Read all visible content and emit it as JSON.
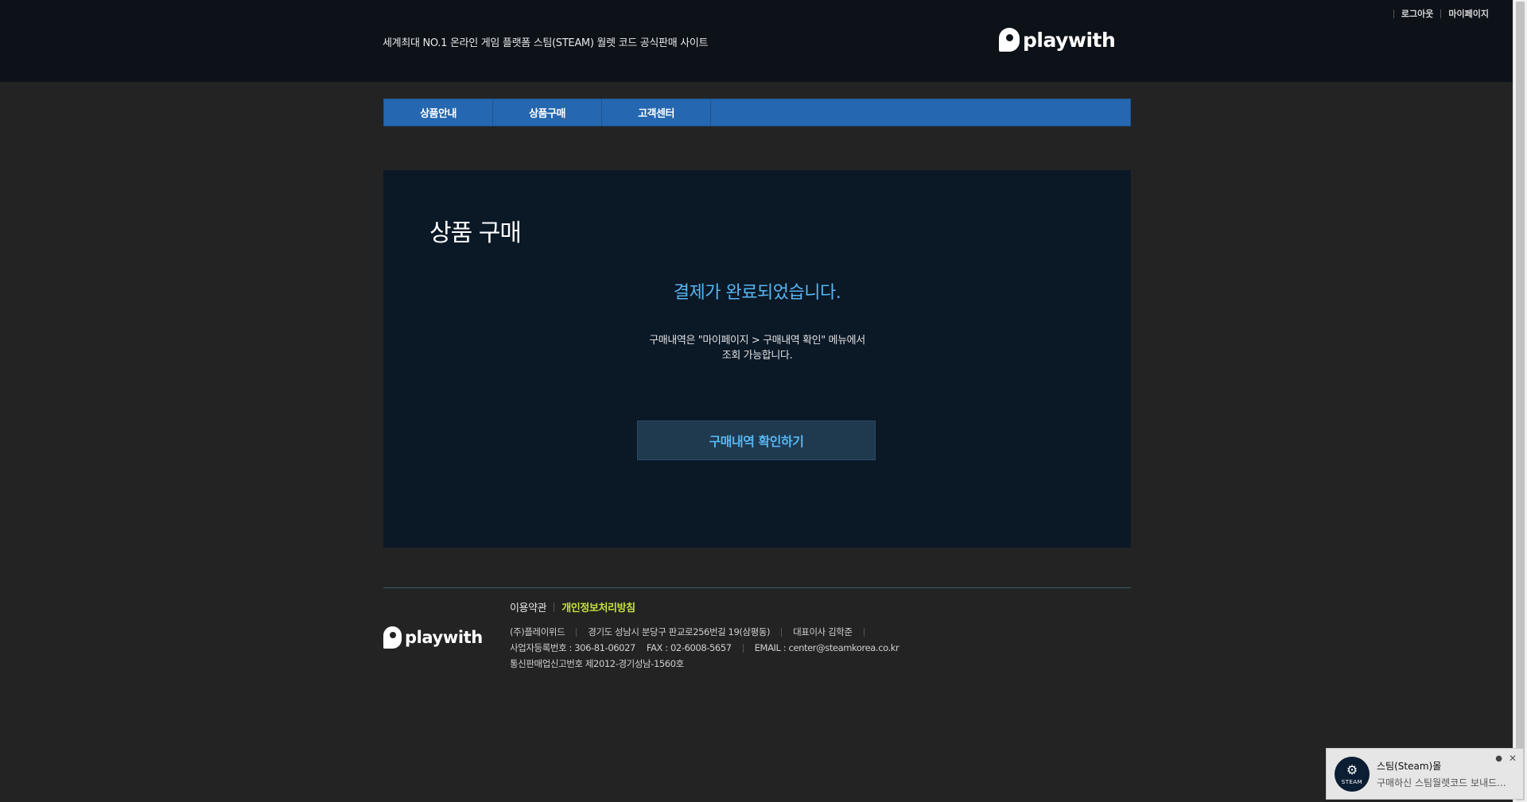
{
  "header": {
    "tagline": "세계최대 NO.1 온라인 게임 플랫폼 스팀(STEAM) 월렛 코드 공식판매 사이트",
    "logo_text": "playwith",
    "util": {
      "logout": "로그아웃",
      "mypage": "마이페이지"
    }
  },
  "nav": {
    "items": [
      {
        "label": "상품안내"
      },
      {
        "label": "상품구매"
      },
      {
        "label": "고객센터"
      }
    ]
  },
  "main": {
    "title": "상품 구매",
    "complete_message": "결제가 완료되었습니다.",
    "info_line1": "구매내역은 \"마이페이지 > 구매내역 확인\" 메뉴에서",
    "info_line2": "조회 가능합니다.",
    "button_label": "구매내역 확인하기"
  },
  "footer": {
    "logo_text": "playwith",
    "terms": "이용약관",
    "privacy": "개인정보처리방침",
    "company_name": "(주)플레이위드",
    "address": "경기도 성남시 분당구 판교로256번길 19(삼평동)",
    "ceo": "대표이사 김학준",
    "biz_no": "사업자등록번호 : 306-81-06027",
    "fax": "FAX : 02-6008-5657",
    "email": "EMAIL : center@steamkorea.co.kr",
    "mail_order_no": "통신판매업신고번호 제2012-경기성남-1560호"
  },
  "toast": {
    "title": "스팀(Steam)몰",
    "body": "구매하신 스팀월렛코드 보내드...",
    "badge_text": "STEAM",
    "icon": "steam-logo-icon"
  },
  "colors": {
    "nav_blue": "#2567b0",
    "accent_blue": "#57b6f0",
    "privacy_green": "#c6e03a",
    "content_bg": "#0b1826"
  }
}
